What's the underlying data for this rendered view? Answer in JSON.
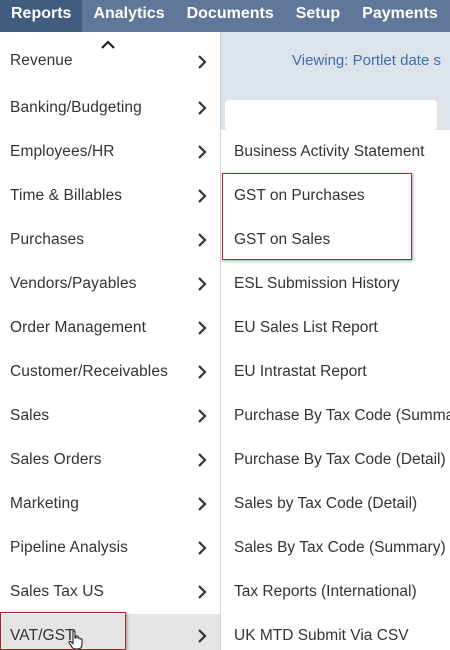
{
  "topnav": [
    "Reports",
    "Analytics",
    "Documents",
    "Setup",
    "Payments"
  ],
  "viewing_text": "Viewing: Portlet date s",
  "menu": {
    "partial_item": "Revenue",
    "items": [
      "Banking/Budgeting",
      "Employees/HR",
      "Time & Billables",
      "Purchases",
      "Vendors/Payables",
      "Order Management",
      "Customer/Receivables",
      "Sales",
      "Sales Orders",
      "Marketing",
      "Pipeline Analysis",
      "Sales Tax US",
      "VAT/GST"
    ]
  },
  "submenu": {
    "items": [
      "Business Activity Statement",
      "GST on Purchases",
      "GST on Sales",
      "ESL Submission History",
      "EU Sales List Report",
      "EU Intrastat Report",
      "Purchase By Tax Code (Summary)",
      "Purchase By Tax Code (Detail)",
      "Sales by Tax Code (Detail)",
      "Sales By Tax Code (Summary)",
      "Tax Reports (International)",
      "UK MTD Submit Via CSV"
    ]
  },
  "colors": {
    "nav": "#607799",
    "nav_active": "#425c80",
    "highlight": "#a8262b",
    "link": "#3d6fa8"
  }
}
